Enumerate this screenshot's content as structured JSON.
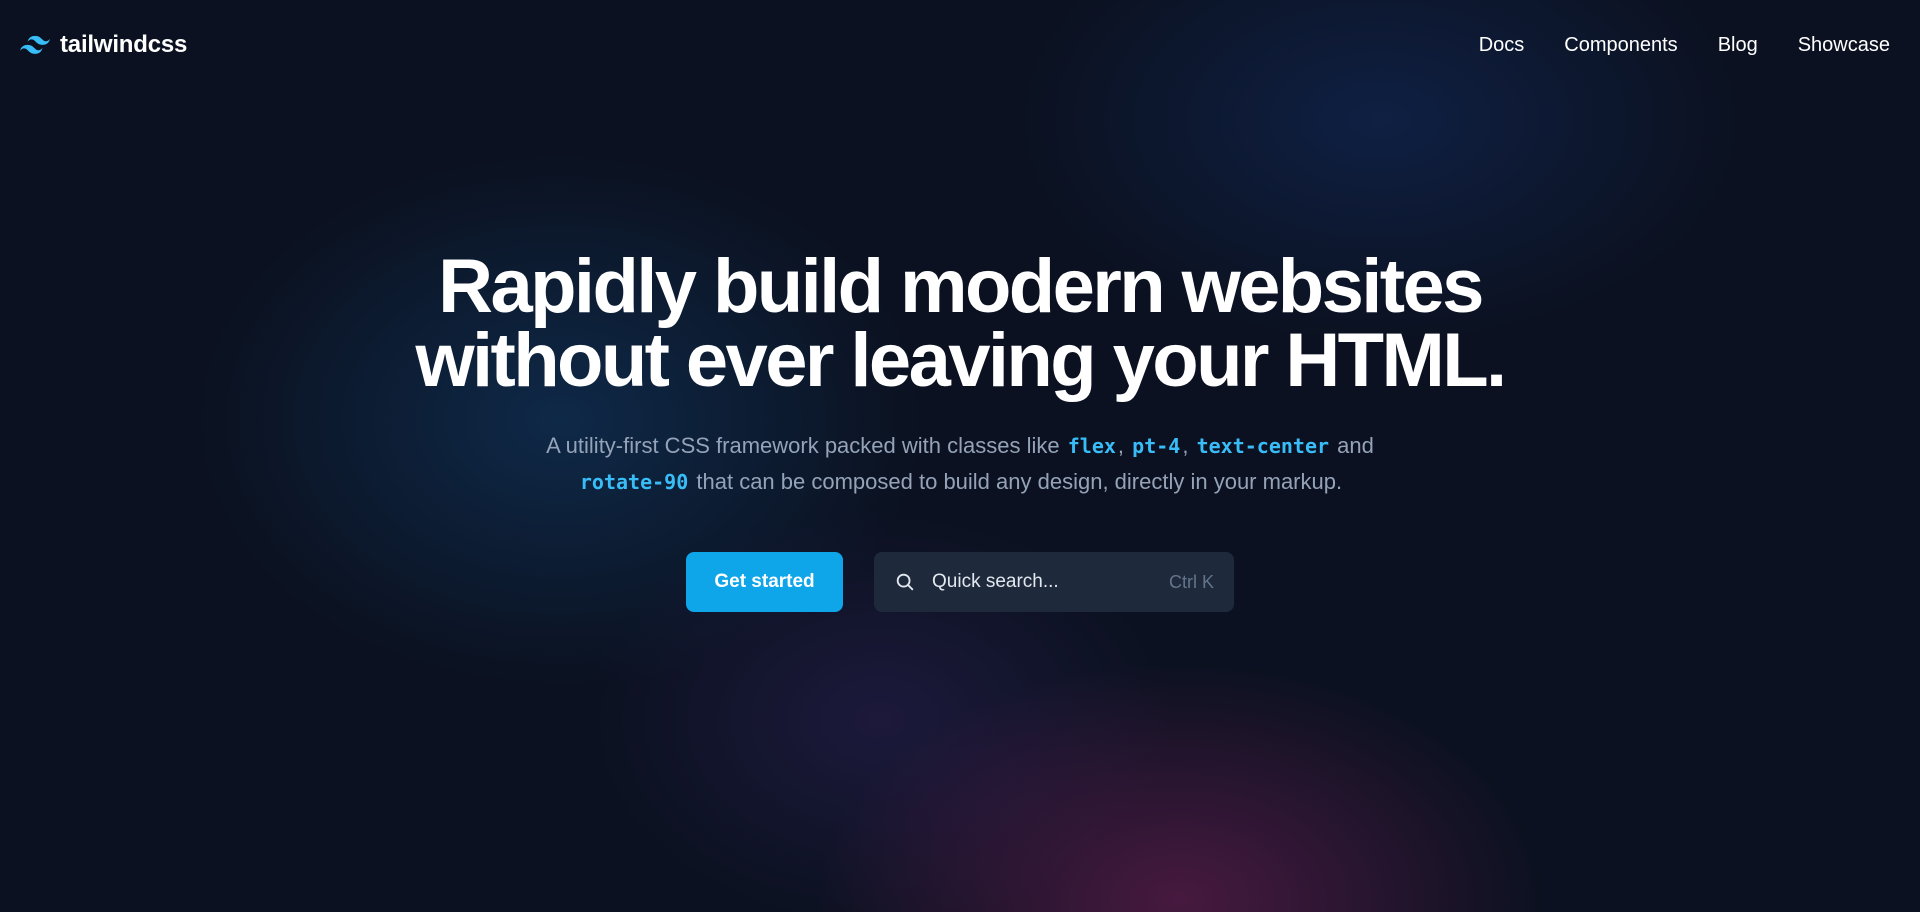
{
  "header": {
    "logo_text": "tailwindcss",
    "nav": [
      {
        "label": "Docs"
      },
      {
        "label": "Components"
      },
      {
        "label": "Blog"
      },
      {
        "label": "Showcase"
      }
    ]
  },
  "hero": {
    "title_line1": "Rapidly build modern websites",
    "title_line2": "without ever leaving your HTML.",
    "subtitle": {
      "text1": "A utility-first CSS framework packed with classes like",
      "code1": "flex",
      "sep1": ",",
      "code2": "pt-4",
      "sep2": ",",
      "code3": "text-center",
      "text2": "and",
      "code4": "rotate-90",
      "text3": "that can be composed to build any design, directly in your markup."
    }
  },
  "actions": {
    "primary_label": "Get started",
    "search_placeholder": "Quick search...",
    "search_shortcut": "Ctrl K",
    "search_icon": "search-icon"
  },
  "colors": {
    "background": "#0b1120",
    "accent": "#0ea5e9",
    "code": "#38bdf8",
    "muted_text": "#94a3b8",
    "search_bg": "#1e293b"
  }
}
